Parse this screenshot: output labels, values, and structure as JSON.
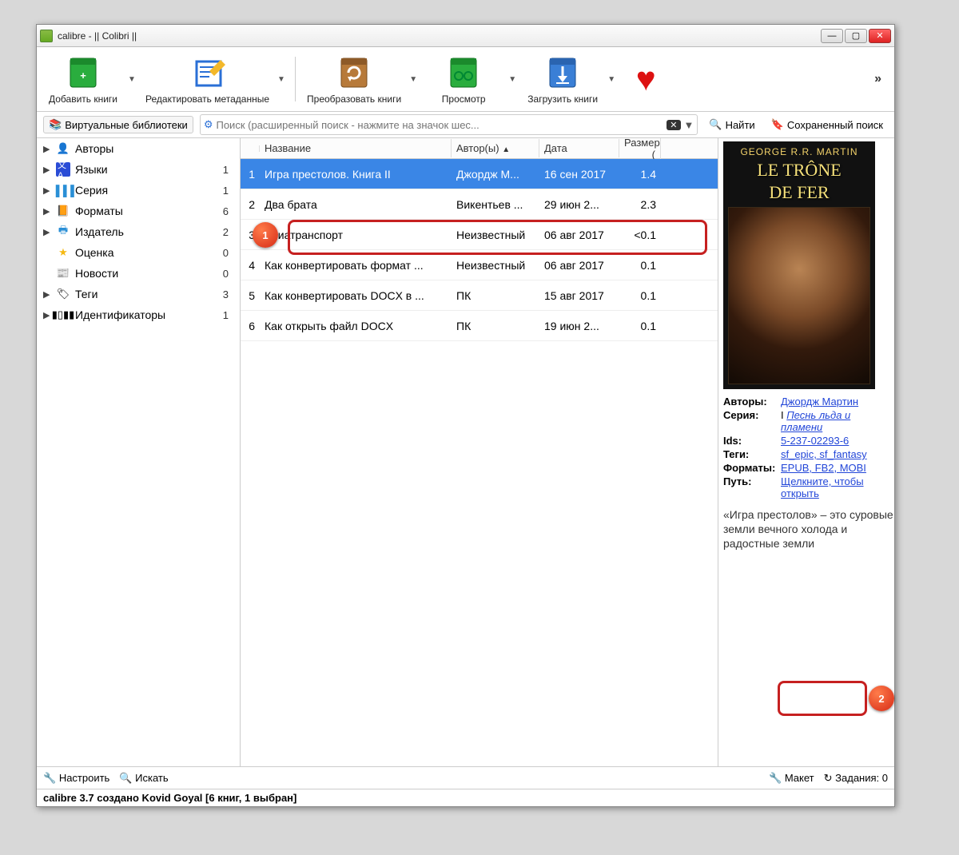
{
  "window": {
    "title": "calibre - || Colibri ||"
  },
  "toolbar": {
    "add": "Добавить книги",
    "edit": "Редактировать метаданные",
    "convert": "Преобразовать книги",
    "view": "Просмотр",
    "download": "Загрузить книги"
  },
  "searchbar": {
    "virtual_libs": "Виртуальные библиотеки",
    "placeholder": "Поиск (расширенный поиск - нажмите на значок шес...",
    "find": "Найти",
    "saved_search": "Сохраненный поиск"
  },
  "sidebar": {
    "items": [
      {
        "label": "Авторы",
        "count": ""
      },
      {
        "label": "Языки",
        "count": "1"
      },
      {
        "label": "Серия",
        "count": "1"
      },
      {
        "label": "Форматы",
        "count": "6"
      },
      {
        "label": "Издатель",
        "count": "2"
      },
      {
        "label": "Оценка",
        "count": "0"
      },
      {
        "label": "Новости",
        "count": "0"
      },
      {
        "label": "Теги",
        "count": "3"
      },
      {
        "label": "Идентификаторы",
        "count": "1"
      }
    ]
  },
  "grid": {
    "cols": [
      "",
      "Название",
      "Автор(ы)",
      "Дата",
      "Размер ("
    ],
    "rows": [
      {
        "n": "1",
        "title": "Игра престолов. Книга II",
        "author": "Джордж М...",
        "date": "16 сен 2017",
        "size": "1.4",
        "sel": true
      },
      {
        "n": "2",
        "title": "Два брата",
        "author": "Викентьев ...",
        "date": "29 июн 2...",
        "size": "2.3"
      },
      {
        "n": "3",
        "title": "Авиатранспорт",
        "author": "Неизвестный",
        "date": "06 авг 2017",
        "size": "<0.1"
      },
      {
        "n": "4",
        "title": "Как конвертировать формат ...",
        "author": "Неизвестный",
        "date": "06 авг 2017",
        "size": "0.1"
      },
      {
        "n": "5",
        "title": "Как конвертировать DOCX в ...",
        "author": "ПК",
        "date": "15 авг 2017",
        "size": "0.1"
      },
      {
        "n": "6",
        "title": "Как открыть файл DOCX",
        "author": "ПК",
        "date": "19 июн 2...",
        "size": "0.1"
      }
    ]
  },
  "details": {
    "cover_author": "GEORGE R.R. MARTIN",
    "cover_title1": "LE TRÔNE",
    "cover_title2": "DE FER",
    "authors_label": "Авторы:",
    "authors_value": "Джордж Мартин",
    "series_label": "Серия:",
    "series_prefix": "I ",
    "series_value": "Песнь льда и пламени",
    "ids_label": "Ids:",
    "ids_value": "5-237-02293-6",
    "tags_label": "Теги:",
    "tags_value": "sf_epic, sf_fantasy",
    "formats_label": "Форматы:",
    "formats_value": "EPUB, FB2, MOBI",
    "path_label": "Путь:",
    "path_value": "Щелкните, чтобы открыть",
    "description": "«Игра престолов» – это суровые земли вечного холода и радостные земли"
  },
  "bottom": {
    "configure": "Настроить",
    "search": "Искать",
    "layout": "Макет",
    "jobs": "Задания: 0"
  },
  "status": {
    "text": "calibre 3.7 создано Kovid Goyal   [6 книг, 1 выбран]"
  },
  "callouts": {
    "b1": "1",
    "b2": "2"
  }
}
